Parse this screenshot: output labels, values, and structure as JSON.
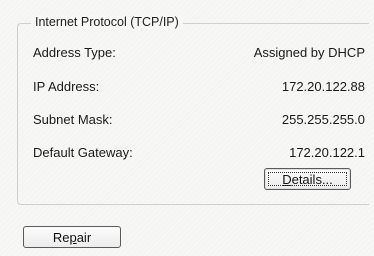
{
  "group": {
    "title": "Internet Protocol (TCP/IP)"
  },
  "rows": [
    {
      "label": "Address Type:",
      "value": "Assigned by DHCP"
    },
    {
      "label": "IP Address:",
      "value": "172.20.122.88"
    },
    {
      "label": "Subnet Mask:",
      "value": "255.255.255.0"
    },
    {
      "label": "Default Gateway:",
      "value": "172.20.122.1"
    }
  ],
  "buttons": {
    "details": {
      "mnemonic": "D",
      "rest": "etails..."
    },
    "repair": {
      "pre": "Re",
      "mnemonic": "p",
      "post": "air"
    }
  }
}
